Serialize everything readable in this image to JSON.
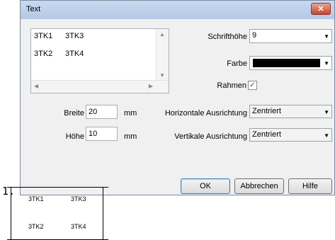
{
  "dialog": {
    "title": "Text",
    "close_label": "✕",
    "list": {
      "items": [
        [
          "3TK1",
          "3TK3"
        ],
        [
          "3TK2",
          "3TK4"
        ]
      ],
      "scroll_up": "▲",
      "scroll_down": "▼",
      "scroll_left": "◀",
      "scroll_right": "▶"
    },
    "breite_label": "Breite",
    "breite_value": "20",
    "breite_unit": "mm",
    "hoehe_label": "Höhe",
    "hoehe_value": "10",
    "hoehe_unit": "mm",
    "schrifthoehe_label": "Schrifthöhe",
    "schrifthoehe_value": "9",
    "farbe_label": "Farbe",
    "farbe_color": "#000000",
    "rahmen_label": "Rahmen",
    "rahmen_checked": "✓",
    "horizontal_label": "Horizontale Ausrichtung",
    "horizontal_value": "Zentriert",
    "vertikal_label": "Vertikale Ausrichtung",
    "vertikal_value": "Zentriert",
    "dropdown_glyph": "▼",
    "buttons": {
      "ok": "OK",
      "cancel": "Abbrechen",
      "help": "Hilfe"
    }
  },
  "figure": {
    "label": "1.",
    "preview": [
      [
        "3TK1",
        "3TK3"
      ],
      [
        "3TK2",
        "3TK4"
      ]
    ]
  }
}
